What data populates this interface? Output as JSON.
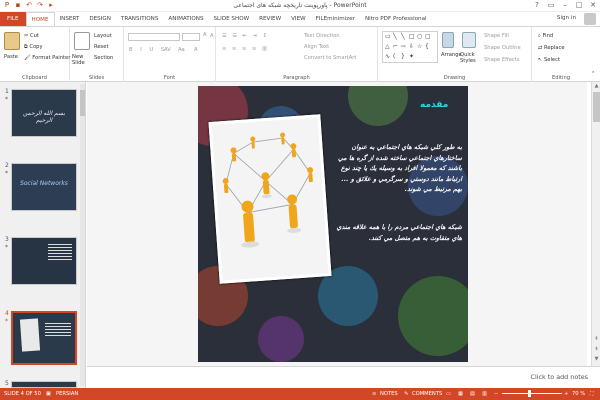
{
  "window": {
    "title": "پاورپوینت تاریخچه شبکه های اجتماعی - PowerPoint",
    "signin": "Sign in"
  },
  "tabs": [
    "FILE",
    "HOME",
    "INSERT",
    "DESIGN",
    "TRANSITIONS",
    "ANIMATIONS",
    "SLIDE SHOW",
    "REVIEW",
    "VIEW",
    "FILEminimizer",
    "Nitro PDF Professional"
  ],
  "ribbon": {
    "clipboard": {
      "label": "Clipboard",
      "paste": "Paste",
      "cut": "Cut",
      "copy": "Copy",
      "format_painter": "Format Painter"
    },
    "slides": {
      "label": "Slides",
      "new_slide": "New Slide",
      "layout": "Layout",
      "reset": "Reset",
      "section": "Section"
    },
    "font": {
      "label": "Font"
    },
    "paragraph": {
      "label": "Paragraph",
      "text_direction": "Text Direction",
      "align_text": "Align Text",
      "convert_smartart": "Convert to SmartArt"
    },
    "drawing": {
      "label": "Drawing",
      "arrange": "Arrange",
      "quick_styles": "Quick Styles",
      "shape_fill": "Shape Fill",
      "shape_outline": "Shape Outline",
      "shape_effects": "Shape Effects"
    },
    "editing": {
      "label": "Editing",
      "find": "Find",
      "replace": "Replace",
      "select": "Select"
    }
  },
  "thumbnails": [
    {
      "num": "1",
      "star": "*",
      "text": "بسم الله الرحمن الرحيم"
    },
    {
      "num": "2",
      "star": "*",
      "text": "Social Networks"
    },
    {
      "num": "3",
      "star": "*",
      "text": ""
    },
    {
      "num": "4",
      "star": "*",
      "text": ""
    },
    {
      "num": "5",
      "star": "",
      "text": ""
    }
  ],
  "slide": {
    "heading": "مقدمه",
    "paragraph1": "به طور كلي شبكه هاي اجتماعي به عنوان ساختارهاي اجتماعي ساخته شده از گره ها مي باشند كه معمولا افراد به وسيله يك يا چند نوع ارتباط مانند دوستي و سرگرمي و علائق و ... بهم مرتبط مي شوند.",
    "paragraph2": "شبكه هاي اجتماعي مردم را با همه علاقه مندي هاي متفاوت به هم متصل مي كنند."
  },
  "notes_placeholder": "Click to add notes",
  "status": {
    "slide_info": "SLIDE 4 OF 50",
    "language": "PERSIAN",
    "notes": "NOTES",
    "comments": "COMMENTS",
    "zoom": "70 %"
  },
  "colors": {
    "accent": "#d24726",
    "heading": "#2ad7f0"
  }
}
